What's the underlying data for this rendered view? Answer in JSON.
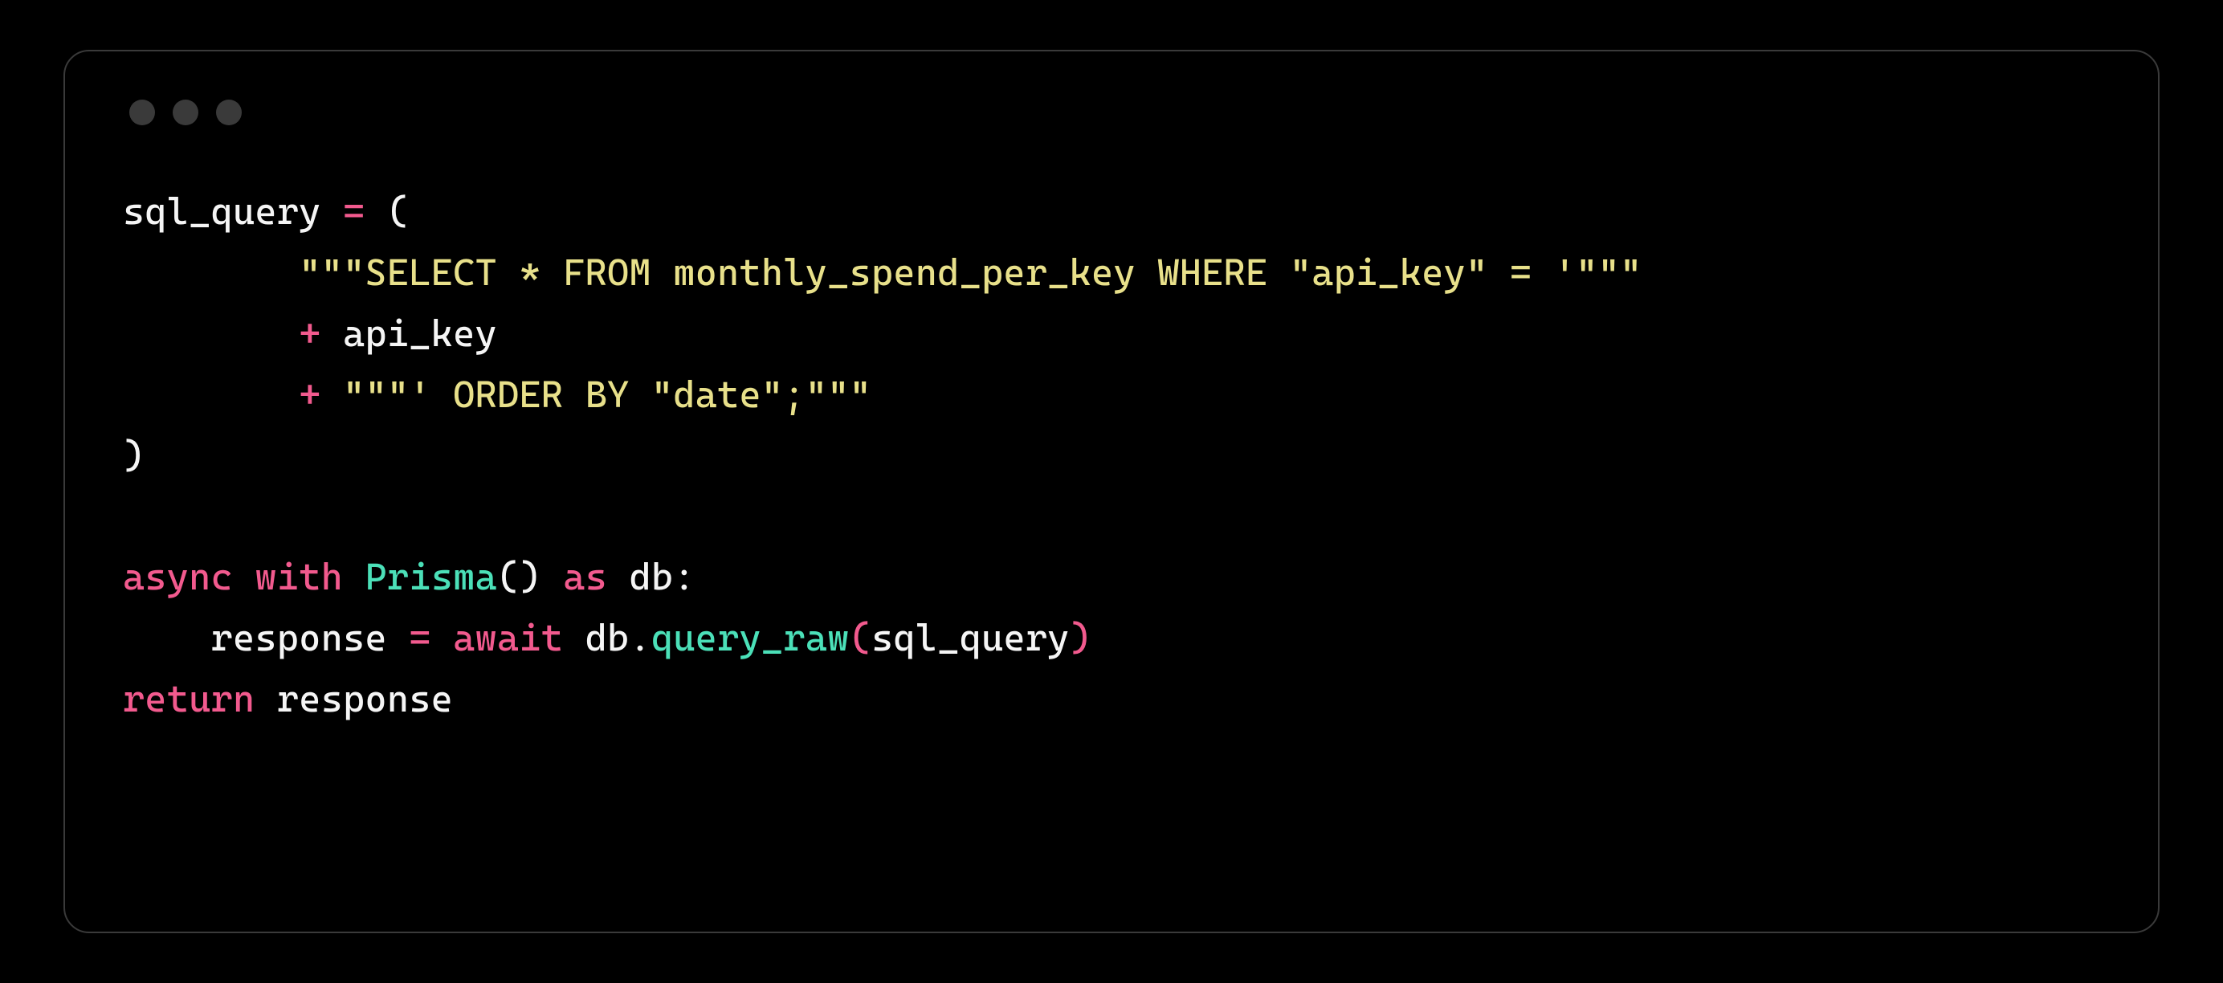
{
  "code": {
    "line1": {
      "var": "sql_query ",
      "eq": "=",
      "open": " ("
    },
    "line2": {
      "indent": "        ",
      "str": "\"\"\"SELECT * FROM monthly_spend_per_key WHERE \"api_key\" = '\"\"\""
    },
    "line3": {
      "indent": "        ",
      "op": "+",
      "var": " api_key"
    },
    "line4": {
      "indent": "        ",
      "op": "+",
      "sp": " ",
      "str": "\"\"\"' ORDER BY \"date\";\"\"\""
    },
    "line5": {
      "close": ")"
    },
    "blank": "",
    "line7": {
      "kw_async": "async",
      "sp1": " ",
      "kw_with": "with",
      "sp2": " ",
      "cls": "Prisma",
      "parens": "()",
      "sp3": " ",
      "kw_as": "as",
      "sp4": " ",
      "var": "db",
      "colon": ":"
    },
    "line8": {
      "indent": "    ",
      "var1": "response ",
      "eq": "=",
      "sp1": " ",
      "kw_await": "await",
      "sp2": " ",
      "obj": "db",
      "dot": ".",
      "method": "query_raw",
      "open": "(",
      "arg": "sql_query",
      "close": ")"
    },
    "line9": {
      "kw_return": "return",
      "sp": " ",
      "var": "response"
    }
  }
}
